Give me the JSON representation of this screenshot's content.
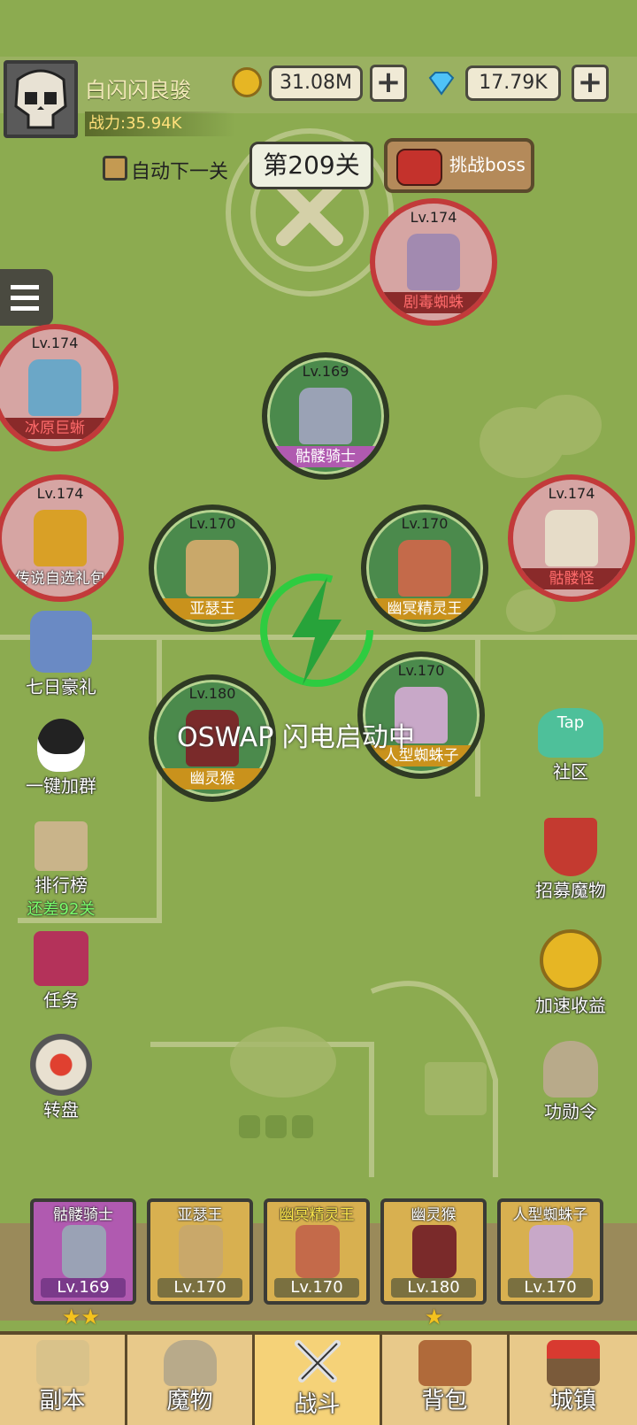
{
  "player": {
    "name": "白闪闪良骏",
    "power": "战力:35.94K"
  },
  "currency": {
    "gold": "31.08M",
    "diamond": "17.79K",
    "plus": "+"
  },
  "stage": {
    "auto_label": "自动下一关",
    "level": "第209关",
    "boss_label": "挑战boss"
  },
  "units": [
    {
      "lv": "Lv.174",
      "name": "剧毒蜘蛛",
      "kind": "enemy"
    },
    {
      "lv": "Lv.174",
      "name": "冰原巨蜥",
      "kind": "enemy"
    },
    {
      "lv": "Lv.169",
      "name": "骷髅骑士",
      "kind": "ally"
    },
    {
      "lv": "Lv.174",
      "name": "传说自选礼包",
      "kind": "enemy"
    },
    {
      "lv": "Lv.170",
      "name": "亚瑟王",
      "kind": "ally"
    },
    {
      "lv": "Lv.170",
      "name": "幽冥精灵王",
      "kind": "ally"
    },
    {
      "lv": "Lv.174",
      "name": "骷髅怪",
      "kind": "enemy"
    },
    {
      "lv": "Lv.180",
      "name": "幽灵猴",
      "kind": "ally"
    },
    {
      "lv": "Lv.170",
      "name": "人型蜘蛛子",
      "kind": "ally"
    }
  ],
  "left_features": [
    {
      "label": "七日豪礼"
    },
    {
      "label": "一键加群"
    },
    {
      "label": "排行榜",
      "sub": "还差92关"
    },
    {
      "label": "任务"
    },
    {
      "label": "转盘"
    }
  ],
  "right_features": [
    {
      "label": "社区",
      "badge": "Tap"
    },
    {
      "label": "招募魔物"
    },
    {
      "label": "加速收益"
    },
    {
      "label": "功勋令"
    }
  ],
  "toast": "OSWAP 闪电启动中",
  "roster": [
    {
      "name": "骷髅骑士",
      "lv": "Lv.169",
      "stars": "★★"
    },
    {
      "name": "亚瑟王",
      "lv": "Lv.170",
      "stars": ""
    },
    {
      "name": "幽冥精灵王",
      "lv": "Lv.170",
      "stars": ""
    },
    {
      "name": "幽灵猴",
      "lv": "Lv.180",
      "stars": "★"
    },
    {
      "name": "人型蜘蛛子",
      "lv": "Lv.170",
      "stars": ""
    }
  ],
  "nav": [
    "副本",
    "魔物",
    "战斗",
    "背包",
    "城镇"
  ]
}
